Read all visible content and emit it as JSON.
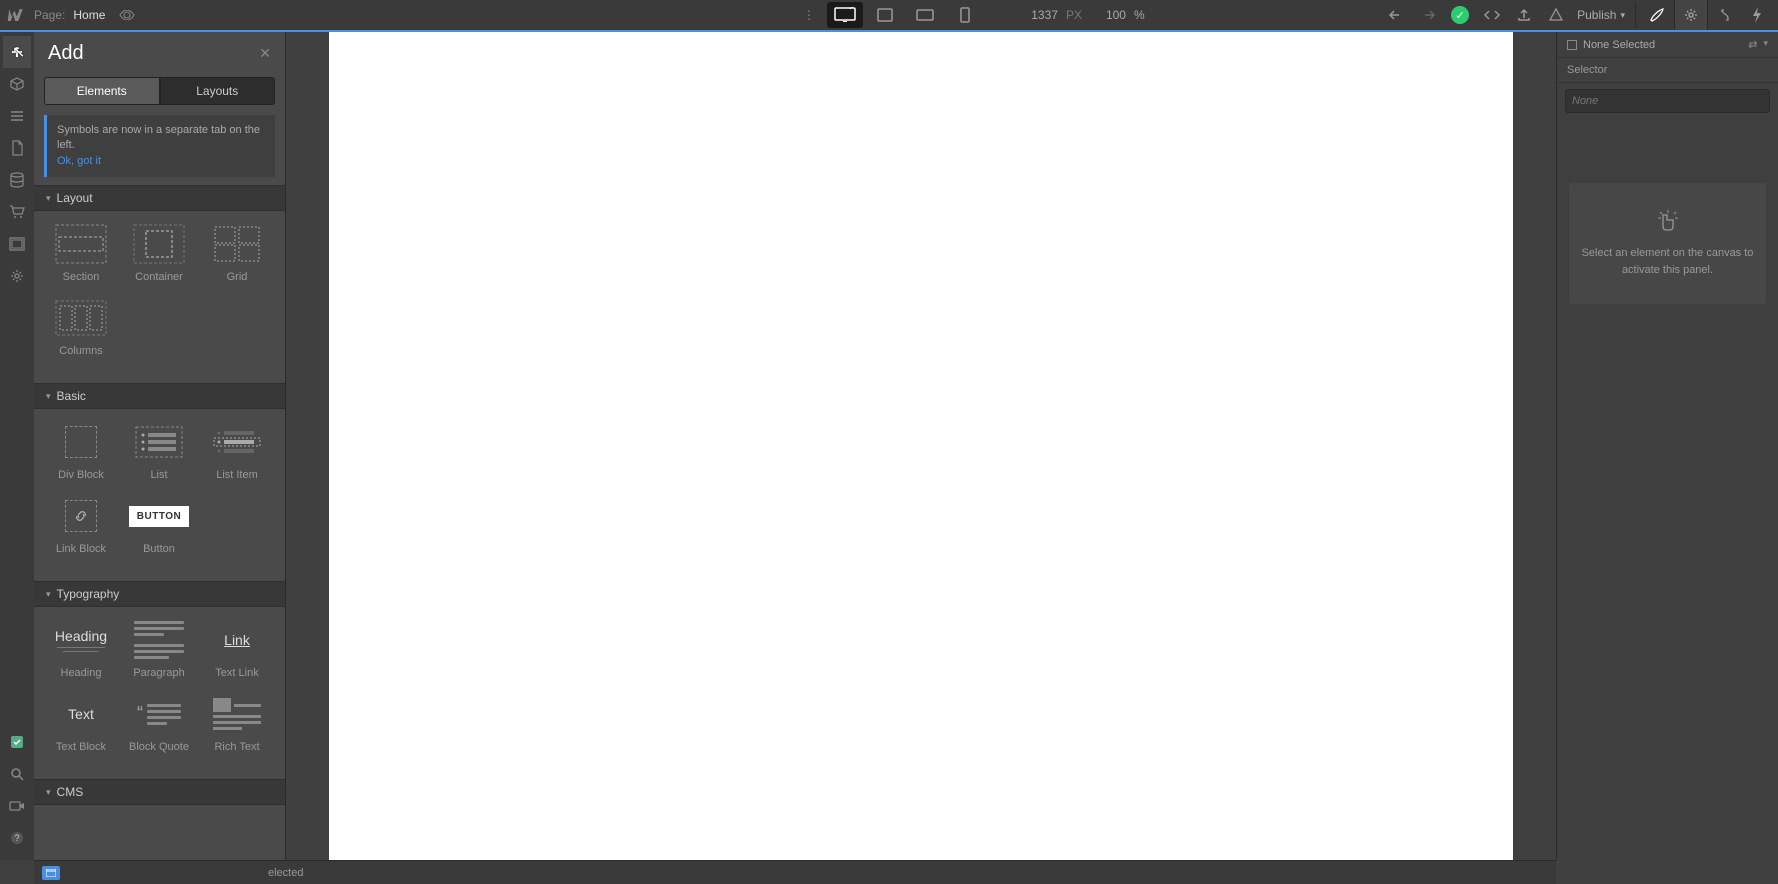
{
  "topbar": {
    "page_label": "Page:",
    "page_name": "Home",
    "width_value": "1337",
    "width_unit": "PX",
    "zoom_value": "100",
    "zoom_unit": "%",
    "publish_label": "Publish"
  },
  "add_panel": {
    "title": "Add",
    "tabs": {
      "elements": "Elements",
      "layouts": "Layouts"
    },
    "info_msg": "Symbols are now in a separate tab on the left.",
    "info_link": "Ok, got it",
    "sections": {
      "layout": {
        "header": "Layout",
        "items": [
          {
            "label": "Section"
          },
          {
            "label": "Container"
          },
          {
            "label": "Grid"
          },
          {
            "label": "Columns"
          }
        ]
      },
      "basic": {
        "header": "Basic",
        "items": [
          {
            "label": "Div Block"
          },
          {
            "label": "List"
          },
          {
            "label": "List Item"
          },
          {
            "label": "Link Block"
          },
          {
            "label": "Button",
            "chip": "BUTTON"
          }
        ]
      },
      "typography": {
        "header": "Typography",
        "items": [
          {
            "label": "Heading",
            "mock": "Heading"
          },
          {
            "label": "Paragraph"
          },
          {
            "label": "Text Link",
            "mock": "Link"
          },
          {
            "label": "Text Block",
            "mock": "Text"
          },
          {
            "label": "Block Quote"
          },
          {
            "label": "Rich Text"
          }
        ]
      },
      "cms": {
        "header": "CMS"
      }
    }
  },
  "right_panel": {
    "none_selected": "None Selected",
    "selector_header": "Selector",
    "selector_placeholder": "None",
    "empty_msg": "Select an element on the canvas to activate this panel."
  },
  "bottombar": {
    "selected_suffix": "elected"
  },
  "icons": {
    "add": "plus-icon",
    "cube": "cube-icon",
    "navigator": "list-icon",
    "pages": "page-icon",
    "cms": "database-icon",
    "ecommerce": "cart-icon",
    "assets": "image-icon",
    "settings": "gear-icon",
    "check": "check-icon",
    "search": "search-icon",
    "video": "video-icon",
    "help": "help-icon"
  },
  "colors": {
    "accent": "#4a90e2",
    "success": "#2ecc71"
  }
}
